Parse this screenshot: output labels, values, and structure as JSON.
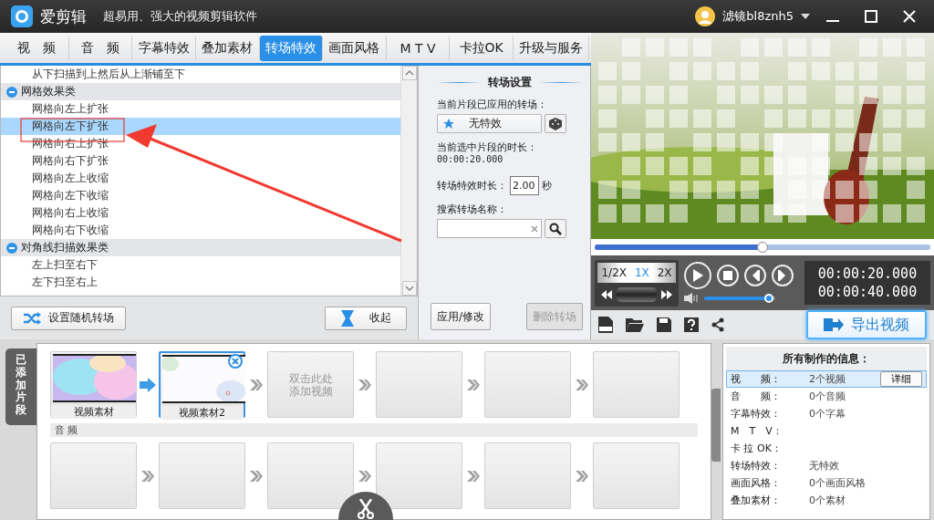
{
  "title_bar": {
    "app_name": "爱剪辑",
    "slogan": "超易用、强大的视频剪辑软件",
    "user_name": "滤镜bl8znh5"
  },
  "tabs": [
    {
      "label": "视　频",
      "selected": false
    },
    {
      "label": "音　频",
      "selected": false
    },
    {
      "label": "字幕特效",
      "selected": false
    },
    {
      "label": "叠加素材",
      "selected": false
    },
    {
      "label": "转场特效",
      "selected": true
    },
    {
      "label": "画面风格",
      "selected": false
    },
    {
      "label": "M T V",
      "selected": false
    },
    {
      "label": "卡拉OK",
      "selected": false
    },
    {
      "label": "升级与服务",
      "selected": false
    }
  ],
  "effect_list": {
    "partial_item": "从下扫描到上然后从上渐铺至下",
    "groups": [
      {
        "label": "网格效果类",
        "expanded": true,
        "children": [
          {
            "label": "网格向左上扩张",
            "selected": false
          },
          {
            "label": "网格向左下扩张",
            "selected": true
          },
          {
            "label": "网格向右上扩张",
            "selected": false
          },
          {
            "label": "网格向右下扩张",
            "selected": false
          },
          {
            "label": "网格向左上收缩",
            "selected": false
          },
          {
            "label": "网格向左下收缩",
            "selected": false
          },
          {
            "label": "网格向右上收缩",
            "selected": false
          },
          {
            "label": "网格向右下收缩",
            "selected": false
          }
        ]
      },
      {
        "label": "对角线扫描效果类",
        "expanded": true,
        "children": [
          {
            "label": "左上扫至右下",
            "selected": false
          },
          {
            "label": "左下扫至右上",
            "selected": false
          }
        ]
      }
    ],
    "buttons": [
      "设置随机转场",
      "收起"
    ]
  },
  "settings": {
    "title": "转场设置",
    "applied_label": "当前片段已应用的转场：",
    "applied_value": "无特效",
    "clip_duration_label": "当前选中片段的时长：",
    "clip_duration": "00:00:20.000",
    "effect_duration_label": "转场特效时长：",
    "effect_duration": "2.00",
    "unit": "秒",
    "search_label": "搜索转场名称：",
    "buttons": [
      {
        "label": "应用/修改",
        "disabled": false
      },
      {
        "label": "删除转场",
        "disabled": true
      }
    ]
  },
  "player": {
    "progress": {
      "level": 0.5
    },
    "speeds": [
      {
        "label": "1/2X",
        "selected": false
      },
      {
        "label": "1X",
        "selected": true
      },
      {
        "label": "2X",
        "selected": false
      }
    ],
    "time_current": "00:00:20.000",
    "time_total": "00:00:40.000",
    "volume": {
      "level": 0.97
    },
    "export_button": "导出视频"
  },
  "clips": {
    "side_tab": "已添加片段",
    "video_slots": [
      {
        "kind": "clip",
        "label": "视频素材",
        "selected": false
      },
      {
        "kind": "clip",
        "label": "视频素材2",
        "selected": true
      },
      {
        "kind": "add",
        "label": "双击此处添加视频"
      },
      {
        "kind": "empty"
      },
      {
        "kind": "empty"
      },
      {
        "kind": "empty"
      }
    ],
    "audio_label": "音 频",
    "audio_slots": [
      {
        "kind": "empty"
      },
      {
        "kind": "empty"
      },
      {
        "kind": "empty"
      },
      {
        "kind": "empty"
      },
      {
        "kind": "empty"
      },
      {
        "kind": "empty"
      }
    ]
  },
  "info": {
    "title": "所有制作的信息：",
    "rows": [
      {
        "label": "视　　频：",
        "value": "2个视频",
        "selected": true,
        "button": "详细"
      },
      {
        "label": "音　　频：",
        "value": "0个音频",
        "selected": false
      },
      {
        "label": "字幕特效：",
        "value": "0个字幕",
        "selected": false
      },
      {
        "label": "M　T　V：",
        "selected": false
      },
      {
        "label": "卡 拉 OK：",
        "selected": false
      },
      {
        "label": "转场特效：",
        "value": "无特效",
        "selected": false
      },
      {
        "label": "画面风格：",
        "value": "0个画面风格",
        "selected": false
      },
      {
        "label": "叠加素材：",
        "value": "0个素材",
        "selected": false
      }
    ]
  }
}
